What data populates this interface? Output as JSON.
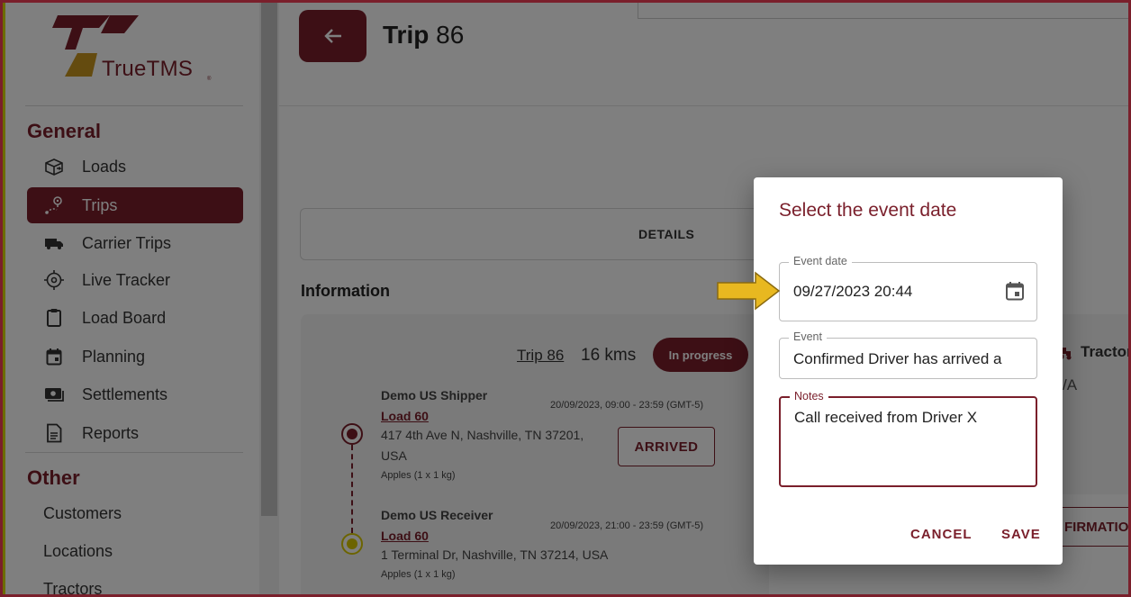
{
  "app": {
    "logo_text": "TrueTMS",
    "logo_sub": "®"
  },
  "sidebar": {
    "general_title": "General",
    "items": [
      {
        "label": "Loads",
        "icon": "box-icon"
      },
      {
        "label": "Trips",
        "icon": "route-icon",
        "active": true
      },
      {
        "label": "Carrier Trips",
        "icon": "truck-icon"
      },
      {
        "label": "Live Tracker",
        "icon": "crosshair-icon"
      },
      {
        "label": "Load Board",
        "icon": "clipboard-icon"
      },
      {
        "label": "Planning",
        "icon": "calendar-icon"
      },
      {
        "label": "Settlements",
        "icon": "money-icon"
      },
      {
        "label": "Reports",
        "icon": "document-icon"
      }
    ],
    "other_title": "Other",
    "other_items": [
      "Customers",
      "Locations",
      "Tractors"
    ]
  },
  "header": {
    "title_bold": "Trip",
    "title_num": "86"
  },
  "tabs": {
    "details_label": "DETAILS"
  },
  "information": {
    "title": "Information",
    "trip_link": "Trip 86",
    "distance": "16 kms",
    "status_badge": "In progress",
    "stops": [
      {
        "name": "Demo US Shipper",
        "load": "Load 60",
        "address_line1": "417 4th Ave N, Nashville, TN 37201,",
        "address_line2": "USA",
        "items": "Apples (1 x 1 kg)",
        "time": "20/09/2023, 09:00 - 23:59 (GMT-5)",
        "action": "ARRIVED"
      },
      {
        "name": "Demo US Receiver",
        "load": "Load 60",
        "address_line1": "1 Terminal Dr, Nashville, TN 37214, USA",
        "items": "Apples (1 x 1 kg)",
        "time": "20/09/2023, 21:00 - 23:59 (GMT-5)"
      }
    ]
  },
  "right_panel": {
    "tractor_label": "Tractor",
    "na_text": "/A",
    "confirm_label": "FIRMATIO"
  },
  "dialog": {
    "title": "Select the event date",
    "event_date_label": "Event date",
    "event_date_value": "09/27/2023 20:44",
    "event_label": "Event",
    "event_value": "Confirmed Driver has arrived a",
    "notes_label": "Notes",
    "notes_value": "Call received from Driver X",
    "cancel_label": "CANCEL",
    "save_label": "SAVE"
  },
  "colors": {
    "brand": "#7a1f2b",
    "accent_yellow": "#e8b820",
    "logo_gold": "#c8961e"
  }
}
